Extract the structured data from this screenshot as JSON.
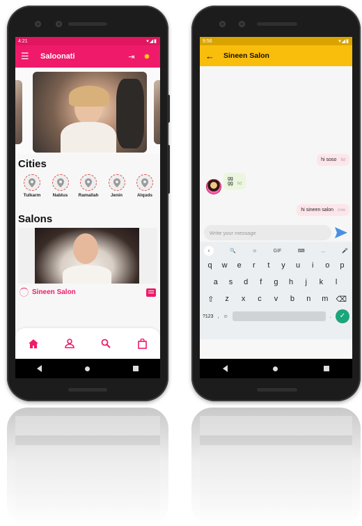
{
  "left_phone": {
    "status": {
      "time": "4:21",
      "icons": "▾◢▮"
    },
    "appbar": {
      "title": "Saloonati"
    },
    "sections": {
      "cities_title": "Cities",
      "salons_title": "Salons"
    },
    "cities": [
      {
        "name": "Tulkarm"
      },
      {
        "name": "Nablus"
      },
      {
        "name": "Ramallah"
      },
      {
        "name": "Jenin"
      },
      {
        "name": "Alquds"
      }
    ],
    "salon": {
      "name": "Sineen Salon"
    },
    "colors": {
      "primary": "#ef1a6a",
      "status": "#e0165f"
    }
  },
  "right_phone": {
    "status": {
      "time": "9:56",
      "icons": "▾◢▮"
    },
    "appbar": {
      "title": "Sineen Salon"
    },
    "messages": [
      {
        "text": "hi soso",
        "time": "8d",
        "direction": "out"
      },
      {
        "text": "gg",
        "subtext": "gg",
        "time": "6d",
        "direction": "in"
      },
      {
        "text": "hi sineen salon",
        "time": "now",
        "direction": "out"
      }
    ],
    "composer": {
      "placeholder": "Write your message"
    },
    "keyboard": {
      "toolbar": [
        "‹",
        "🔍",
        "☺",
        "GIF",
        "⌨",
        "…",
        "🎤"
      ],
      "row1": [
        "q",
        "w",
        "e",
        "r",
        "t",
        "y",
        "u",
        "i",
        "o",
        "p"
      ],
      "row2": [
        "a",
        "s",
        "d",
        "f",
        "g",
        "h",
        "j",
        "k",
        "l"
      ],
      "row3": [
        "z",
        "x",
        "c",
        "v",
        "b",
        "n",
        "m"
      ],
      "symbols": "?123",
      "comma": ",",
      "period": "."
    },
    "colors": {
      "primary": "#f9bd0b",
      "status": "#d9a400",
      "send": "#4a90e2"
    }
  }
}
